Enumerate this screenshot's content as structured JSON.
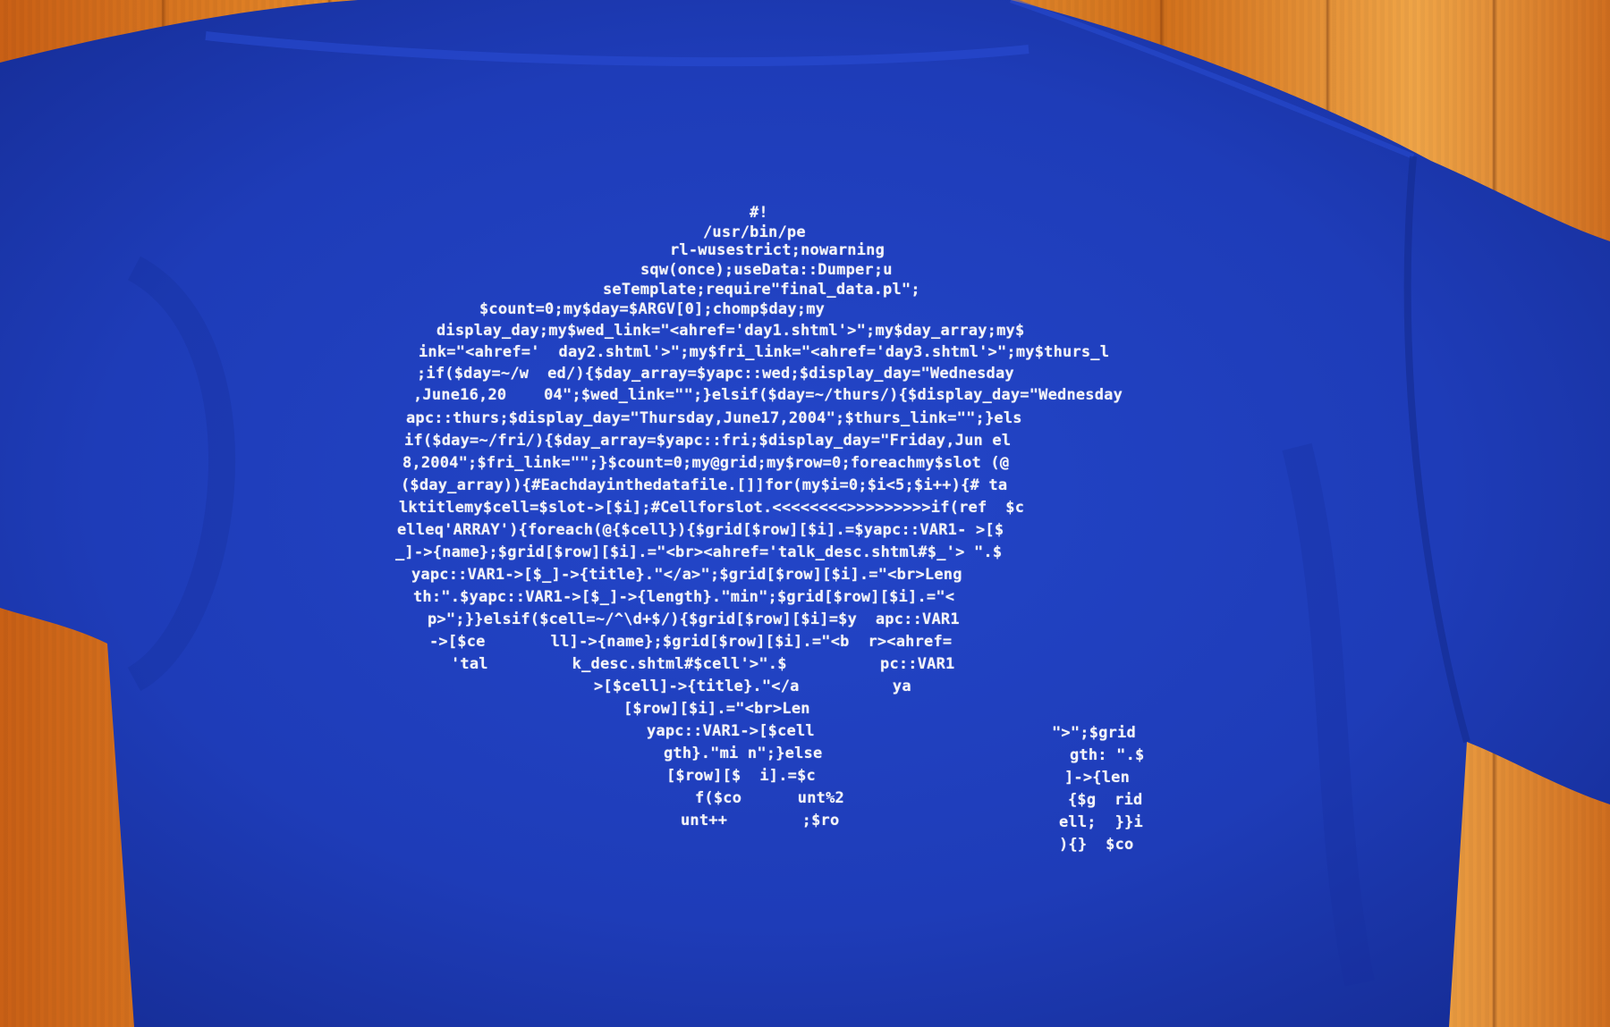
{
  "colors": {
    "shirt": "#1f3fbf",
    "shirt_shadow": "#152c94",
    "print": "#f4f4f8",
    "floor": "#d2721c"
  },
  "print": {
    "lines": [
      "#!",
      "/usr/bin/pe",
      "rl-wusestrict;nowarning",
      "sqw(once);useData::Dumper;u",
      "seTemplate;require\"final_data.pl\";",
      "$count=0;my$day=$ARGV[0];chomp$day;my",
      "display_day;my$wed_link=\"<ahref='day1.shtml'>\";my$day_array;my$",
      "ink=\"<ahref='  day2.shtml'>\";my$fri_link=\"<ahref='day3.shtml'>\";my$thurs_l",
      ";if($day=~/w  ed/){$day_array=$yapc::wed;$display_day=\"Wednesday",
      ",June16,20    04\";$wed_link=\"\";}elsif($day=~/thurs/){$display_day=\"Wednesday",
      "apc::thurs;$display_day=\"Thursday,June17,2004\";$thurs_link=\"\";}els",
      "if($day=~/fri/){$day_array=$yapc::fri;$display_day=\"Friday,Jun el",
      "8,2004\";$fri_link=\"\";}$count=0;my@grid;my$row=0;foreachmy$slot (@",
      "($day_array)){#Eachdayinthedatafile.[]]for(my$i=0;$i<5;$i++){# ta",
      "lktitlemy$cell=$slot->[$i];#Cellforslot.<<<<<<<<>>>>>>>>>if(ref  $c",
      "elleq'ARRAY'){foreach(@{$cell}){$grid[$row][$i].=$yapc::VAR1- >[$",
      "_]->{name};$grid[$row][$i].=\"<br><ahref='talk_desc.shtml#$_'> \".$",
      "yapc::VAR1->[$_]->{title}.\"</a>\";$grid[$row][$i].=\"<br>Leng",
      "th:\".$yapc::VAR1->[$_]->{length}.\"min\";$grid[$row][$i].=\"<",
      "p>\";}}elsif($cell=~/^\\d+$/){$grid[$row][$i]=$y  apc::VAR1",
      "->[$ce       ll]->{name};$grid[$row][$i].=\"<b  r><ahref=",
      "'tal         k_desc.shtml#$cell'>\".$          pc::VAR1",
      ">[$cell]->{title}.\"</a          ya",
      "[$row][$i].=\"<br>Len",
      "yapc::VAR1->[$cell",
      "gth}.\"mi n\";}else",
      "[$row][$  i].=$c",
      "f($co      unt%2",
      "unt++        ;$ro",
      "\">\";$grid",
      "gth: \".$",
      "]->{len",
      "{$g  rid",
      "ell;  }}i",
      "){}  $co"
    ]
  }
}
